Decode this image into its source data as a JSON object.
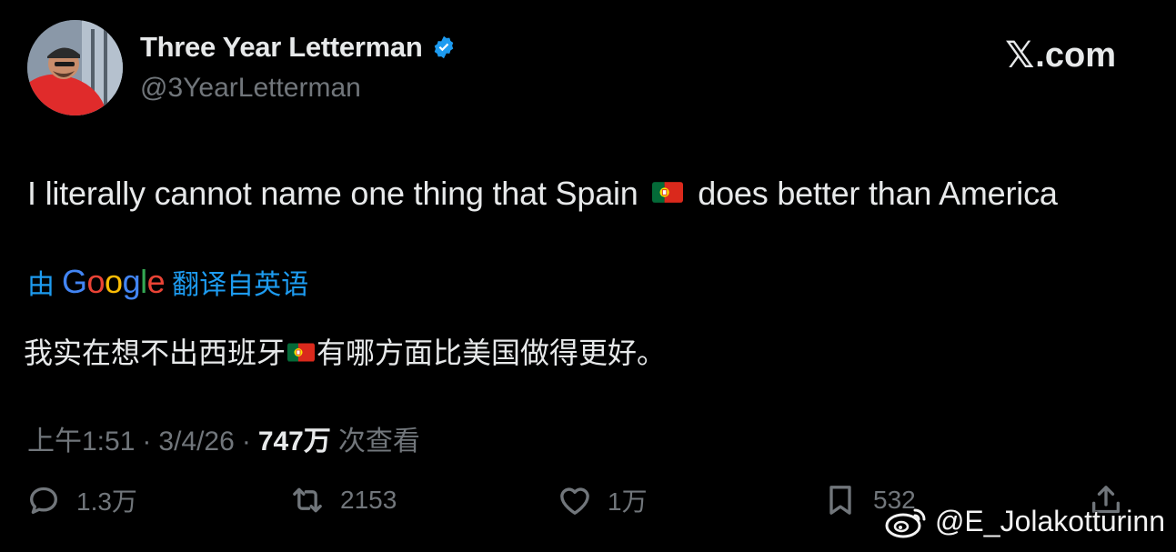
{
  "author": {
    "display_name": "Three Year Letterman",
    "handle": "@3YearLetterman",
    "avatar_icon": "user-avatar",
    "verified_icon": "verified-badge-icon",
    "verified_color": "#1d9bf0"
  },
  "brand": {
    "label": ".com",
    "icon": "x-logo-icon"
  },
  "tweet": {
    "text_before": "I literally cannot name one thing that Spain",
    "text_after": "does better than America",
    "flag_icon": "portugal-flag-icon"
  },
  "translation": {
    "prefix": "由",
    "google_letters": [
      "G",
      "o",
      "o",
      "g",
      "l",
      "e"
    ],
    "suffix": "翻译自英语",
    "text_before": "我实在想不出西班牙",
    "text_after": "有哪方面比美国做得更好。"
  },
  "meta": {
    "time": "上午1:51",
    "date": "3/4/26",
    "views_count": "747万",
    "views_label": "次查看",
    "separator": "·"
  },
  "actions": {
    "reply_count": "1.3万",
    "retweet_count": "2153",
    "like_count": "1万",
    "bookmark_count": "532"
  },
  "watermark": {
    "text": "@E_Jolakotturinn",
    "icon": "weibo-logo-icon"
  },
  "colors": {
    "background": "#000000",
    "text_primary": "#e7e9ea",
    "text_secondary": "#71767b",
    "accent_blue": "#1d9bf0"
  }
}
